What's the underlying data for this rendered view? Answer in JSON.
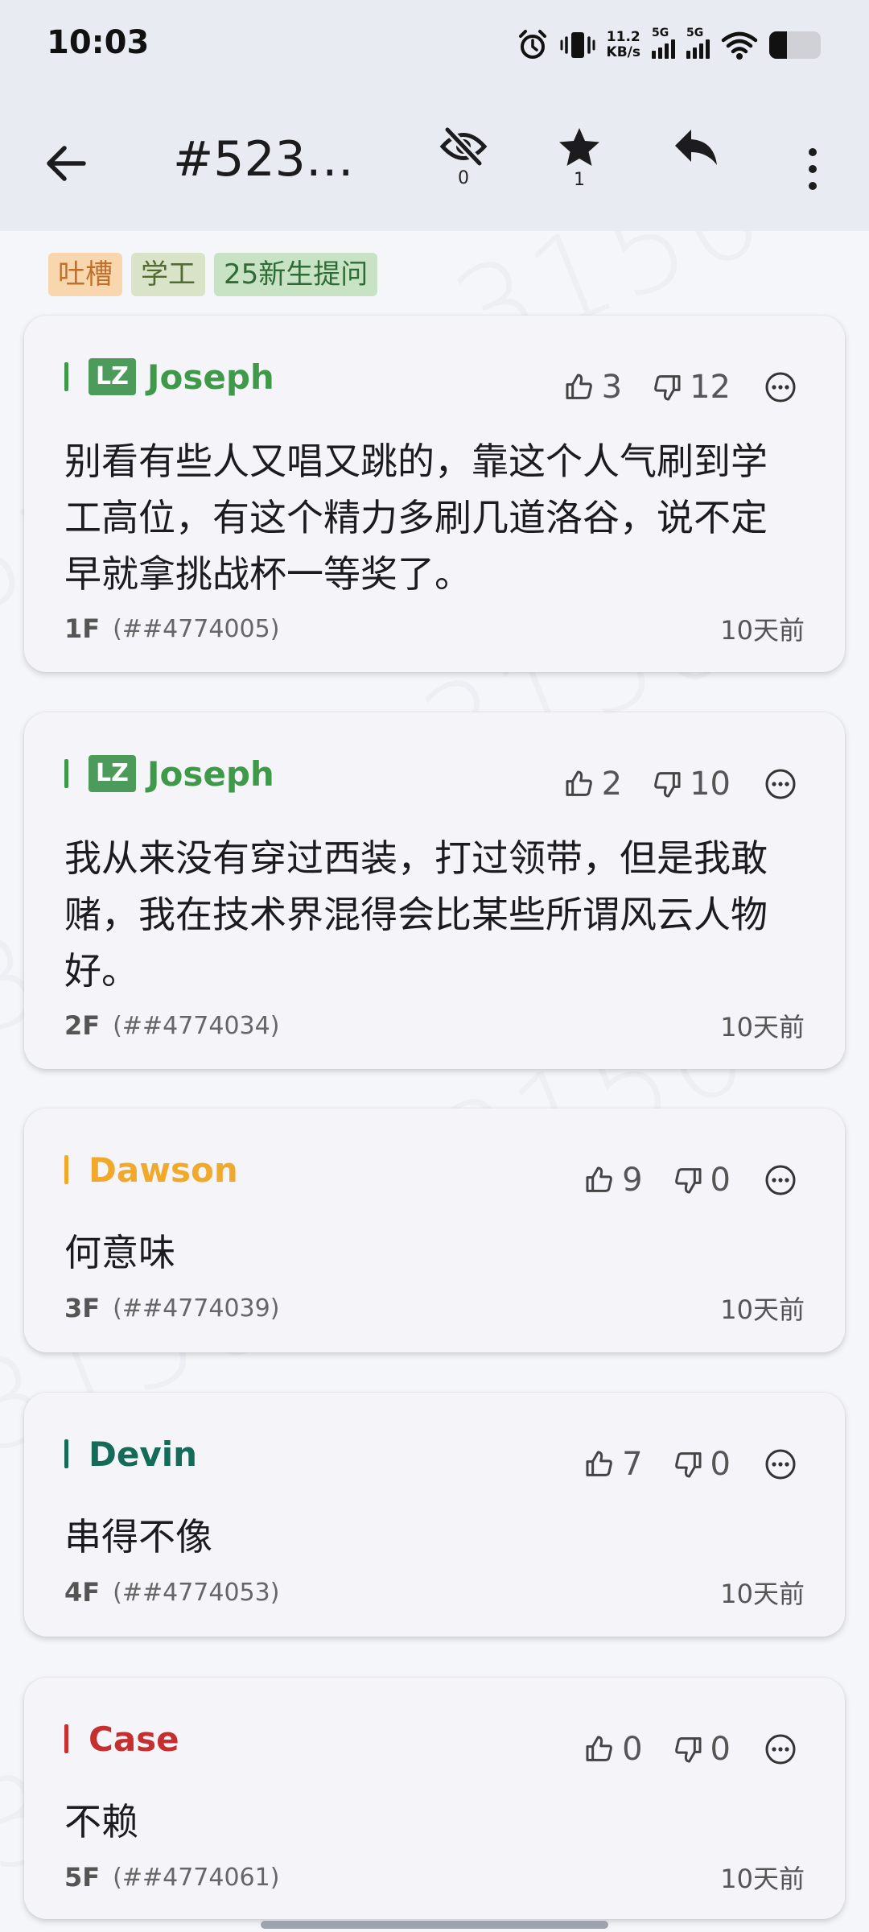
{
  "status_bar": {
    "time": "10:03",
    "net_speed_value": "11.2",
    "net_speed_unit": "KB/s",
    "sim1_label": "5G",
    "sim2_label": "5G",
    "battery_level": 0.34
  },
  "header": {
    "back_icon": "arrow-left-icon",
    "title": "#523…",
    "hide_count": "0",
    "star_count": "1",
    "reply_icon": "reply-icon",
    "more_icon": "more-vertical-icon"
  },
  "tags": [
    {
      "label": "吐槽",
      "bg": "#f8d7ae",
      "fg": "#c0702a"
    },
    {
      "label": "学工",
      "bg": "#d9e3c7",
      "fg": "#526b32"
    },
    {
      "label": "25新生提问",
      "bg": "#c7e3c4",
      "fg": "#2f6b36"
    }
  ],
  "watermark": "3150",
  "floors": [
    {
      "author": "Joseph",
      "is_lz": true,
      "lz_label": "LZ",
      "author_color": "#3e9a49",
      "likes": "3",
      "dislikes": "12",
      "content": "别看有些人又唱又跳的，靠这个人气刷到学工高位，有这个精力多刷几道洛谷，说不定早就拿挑战杯一等奖了。",
      "floor": "1F",
      "floor_id": "(##4774005)",
      "time": "10天前"
    },
    {
      "author": "Joseph",
      "is_lz": true,
      "lz_label": "LZ",
      "author_color": "#3e9a49",
      "likes": "2",
      "dislikes": "10",
      "content": "我从来没有穿过西装，打过领带，但是我敢赌，我在技术界混得会比某些所谓风云人物好。",
      "floor": "2F",
      "floor_id": "(##4774034)",
      "time": "10天前"
    },
    {
      "author": "Dawson",
      "is_lz": false,
      "author_color": "#f0a92b",
      "likes": "9",
      "dislikes": "0",
      "content": "何意味",
      "floor": "3F",
      "floor_id": "(##4774039)",
      "time": "10天前"
    },
    {
      "author": "Devin",
      "is_lz": false,
      "author_color": "#136b58",
      "likes": "7",
      "dislikes": "0",
      "content": "串得不像",
      "floor": "4F",
      "floor_id": "(##4774053)",
      "time": "10天前"
    },
    {
      "author": "Case",
      "is_lz": false,
      "author_color": "#c62f2f",
      "likes": "0",
      "dislikes": "0",
      "content": "不赖",
      "floor": "5F",
      "floor_id": "(##4774061)",
      "time": "10天前"
    }
  ]
}
